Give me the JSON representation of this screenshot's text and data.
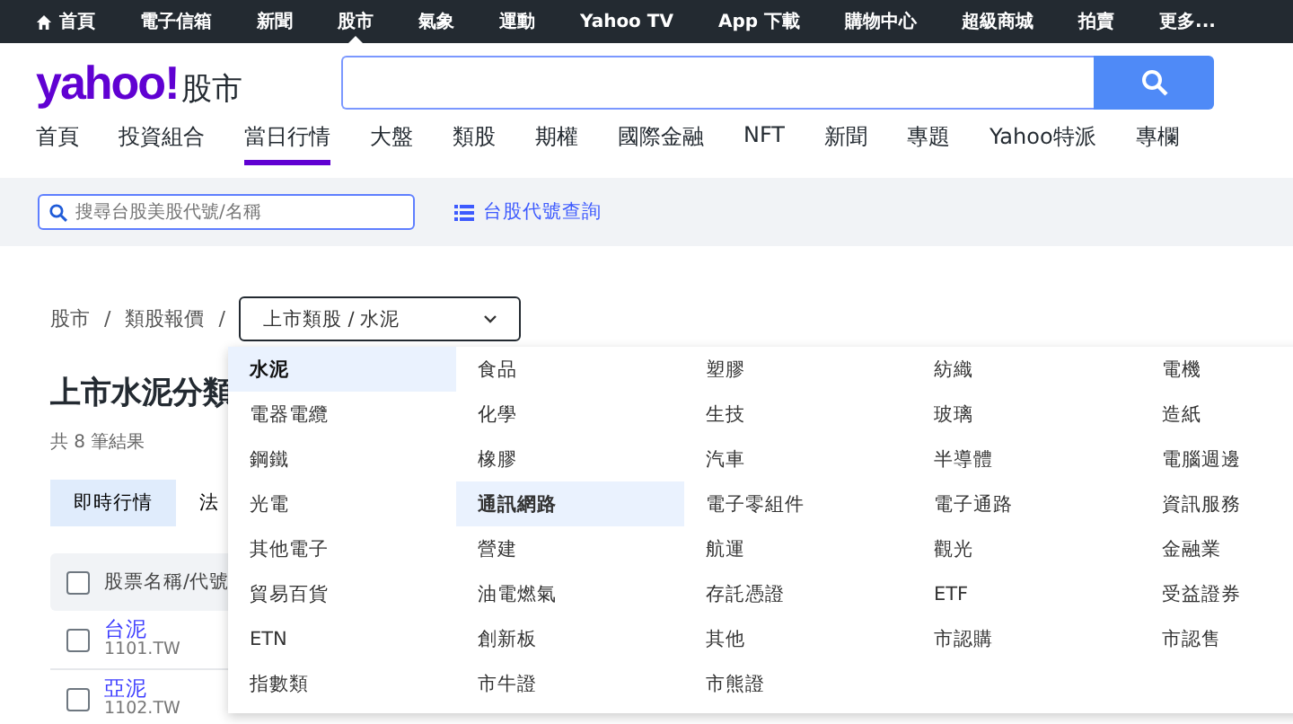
{
  "top_bar": [
    {
      "label": "首頁",
      "home": true,
      "selected": false
    },
    {
      "label": "電子信箱",
      "home": false,
      "selected": false
    },
    {
      "label": "新聞",
      "home": false,
      "selected": false
    },
    {
      "label": "股市",
      "home": false,
      "selected": true
    },
    {
      "label": "氣象",
      "home": false,
      "selected": false
    },
    {
      "label": "運動",
      "home": false,
      "selected": false
    },
    {
      "label": "Yahoo TV",
      "home": false,
      "selected": false
    },
    {
      "label": "App 下載",
      "home": false,
      "selected": false
    },
    {
      "label": "購物中心",
      "home": false,
      "selected": false
    },
    {
      "label": "超級商城",
      "home": false,
      "selected": false
    },
    {
      "label": "拍賣",
      "home": false,
      "selected": false
    },
    {
      "label": "更多...",
      "home": false,
      "selected": false
    }
  ],
  "logo": {
    "brand": "yahoo!",
    "section": "股市"
  },
  "nav": [
    {
      "label": "首頁",
      "selected": false
    },
    {
      "label": "投資組合",
      "selected": false
    },
    {
      "label": "當日行情",
      "selected": true
    },
    {
      "label": "大盤",
      "selected": false
    },
    {
      "label": "類股",
      "selected": false
    },
    {
      "label": "期權",
      "selected": false
    },
    {
      "label": "國際金融",
      "selected": false
    },
    {
      "label": "NFT",
      "selected": false
    },
    {
      "label": "新聞",
      "selected": false
    },
    {
      "label": "專題",
      "selected": false
    },
    {
      "label": "Yahoo特派",
      "selected": false
    },
    {
      "label": "專欄",
      "selected": false
    }
  ],
  "quote_search": {
    "placeholder": "搜尋台股美股代號/名稱"
  },
  "code_lookup_link": "台股代號查詢",
  "breadcrumb": [
    {
      "label": "股市",
      "separator": "/"
    },
    {
      "label": "類股報價",
      "separator": "/"
    }
  ],
  "category_select": {
    "value": "上市類股 / 水泥",
    "expanded": true
  },
  "dropdown_items": [
    {
      "label": "水泥",
      "selected": true,
      "hovered": false
    },
    {
      "label": "食品",
      "selected": false,
      "hovered": false
    },
    {
      "label": "塑膠",
      "selected": false,
      "hovered": false
    },
    {
      "label": "紡織",
      "selected": false,
      "hovered": false
    },
    {
      "label": "電機",
      "selected": false,
      "hovered": false
    },
    {
      "label": "電器電纜",
      "selected": false,
      "hovered": false
    },
    {
      "label": "化學",
      "selected": false,
      "hovered": false
    },
    {
      "label": "生技",
      "selected": false,
      "hovered": false
    },
    {
      "label": "玻璃",
      "selected": false,
      "hovered": false
    },
    {
      "label": "造紙",
      "selected": false,
      "hovered": false
    },
    {
      "label": "鋼鐵",
      "selected": false,
      "hovered": false
    },
    {
      "label": "橡膠",
      "selected": false,
      "hovered": false
    },
    {
      "label": "汽車",
      "selected": false,
      "hovered": false
    },
    {
      "label": "半導體",
      "selected": false,
      "hovered": false
    },
    {
      "label": "電腦週邊",
      "selected": false,
      "hovered": false
    },
    {
      "label": "光電",
      "selected": false,
      "hovered": false
    },
    {
      "label": "通訊網路",
      "selected": false,
      "hovered": true
    },
    {
      "label": "電子零組件",
      "selected": false,
      "hovered": false
    },
    {
      "label": "電子通路",
      "selected": false,
      "hovered": false
    },
    {
      "label": "資訊服務",
      "selected": false,
      "hovered": false
    },
    {
      "label": "其他電子",
      "selected": false,
      "hovered": false
    },
    {
      "label": "營建",
      "selected": false,
      "hovered": false
    },
    {
      "label": "航運",
      "selected": false,
      "hovered": false
    },
    {
      "label": "觀光",
      "selected": false,
      "hovered": false
    },
    {
      "label": "金融業",
      "selected": false,
      "hovered": false
    },
    {
      "label": "貿易百貨",
      "selected": false,
      "hovered": false
    },
    {
      "label": "油電燃氣",
      "selected": false,
      "hovered": false
    },
    {
      "label": "存託憑證",
      "selected": false,
      "hovered": false
    },
    {
      "label": "ETF",
      "selected": false,
      "hovered": false
    },
    {
      "label": "受益證券",
      "selected": false,
      "hovered": false
    },
    {
      "label": "ETN",
      "selected": false,
      "hovered": false
    },
    {
      "label": "創新板",
      "selected": false,
      "hovered": false
    },
    {
      "label": "其他",
      "selected": false,
      "hovered": false
    },
    {
      "label": "市認購",
      "selected": false,
      "hovered": false
    },
    {
      "label": "市認售",
      "selected": false,
      "hovered": false
    },
    {
      "label": "指數類",
      "selected": false,
      "hovered": false
    },
    {
      "label": "市牛證",
      "selected": false,
      "hovered": false
    },
    {
      "label": "市熊證",
      "selected": false,
      "hovered": false
    }
  ],
  "page_title": "上市水泥分類",
  "result_count": "共 8 筆結果",
  "view_tabs": [
    {
      "label": "即時行情",
      "selected": true
    },
    {
      "label": "法",
      "selected": false
    }
  ],
  "table": {
    "header": {
      "label": "股票名稱/代號",
      "checked": false
    },
    "rows": [
      {
        "name": "台泥",
        "code": "1101.TW",
        "checked": false
      },
      {
        "name": "亞泥",
        "code": "1102.TW",
        "checked": false
      }
    ]
  }
}
